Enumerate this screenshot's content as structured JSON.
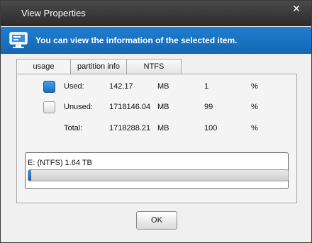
{
  "window": {
    "title": "View Properties",
    "close_glyph": "✕"
  },
  "banner": {
    "icon": "drive-properties-icon",
    "message": "You can view the information of the selected item."
  },
  "tabs": [
    {
      "label": "usage",
      "active": true
    },
    {
      "label": "partition info",
      "active": false
    },
    {
      "label": "NTFS",
      "active": false
    }
  ],
  "usage": {
    "rows": [
      {
        "label": "Used:",
        "value": "142.17",
        "unit": "MB",
        "percent": "1",
        "percent_sign": "%",
        "swatch": "#1c6fc0"
      },
      {
        "label": "Unused:",
        "value": "1718146.04",
        "unit": "MB",
        "percent": "99",
        "percent_sign": "%",
        "swatch": "#e8e8e8"
      },
      {
        "label": "Total:",
        "value": "1718288.21",
        "unit": "MB",
        "percent": "100",
        "percent_sign": "%"
      }
    ]
  },
  "drive": {
    "label": "E: (NTFS) 1.64 TB",
    "used_fraction": 0.01
  },
  "buttons": {
    "ok": "OK"
  },
  "colors": {
    "titlebar": "#2b2b2b",
    "banner": "#1567b3",
    "used_fill": "#1c6fc0"
  }
}
